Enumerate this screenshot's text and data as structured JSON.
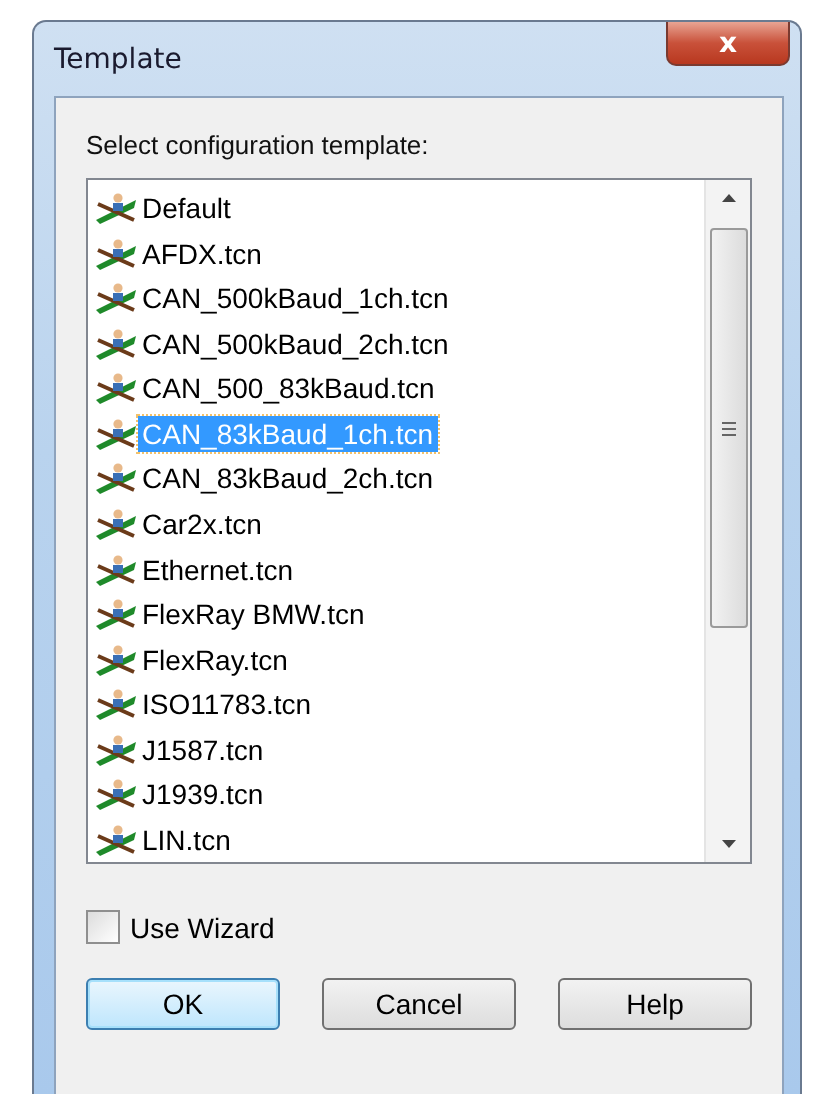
{
  "window": {
    "title": "Template",
    "close": "x"
  },
  "prompt": "Select configuration template:",
  "templates": [
    {
      "label": "Default",
      "selected": false
    },
    {
      "label": "AFDX.tcn",
      "selected": false
    },
    {
      "label": "CAN_500kBaud_1ch.tcn",
      "selected": false
    },
    {
      "label": "CAN_500kBaud_2ch.tcn",
      "selected": false
    },
    {
      "label": "CAN_500_83kBaud.tcn",
      "selected": false
    },
    {
      "label": "CAN_83kBaud_1ch.tcn",
      "selected": true
    },
    {
      "label": "CAN_83kBaud_2ch.tcn",
      "selected": false
    },
    {
      "label": "Car2x.tcn",
      "selected": false
    },
    {
      "label": "Ethernet.tcn",
      "selected": false
    },
    {
      "label": "FlexRay BMW.tcn",
      "selected": false
    },
    {
      "label": "FlexRay.tcn",
      "selected": false
    },
    {
      "label": "ISO11783.tcn",
      "selected": false
    },
    {
      "label": "J1587.tcn",
      "selected": false
    },
    {
      "label": "J1939.tcn",
      "selected": false
    },
    {
      "label": "LIN.tcn",
      "selected": false
    }
  ],
  "use_wizard": {
    "label": "Use Wizard",
    "checked": false
  },
  "buttons": [
    {
      "label": "OK",
      "default": true
    },
    {
      "label": "Cancel",
      "default": false
    },
    {
      "label": "Help",
      "default": false
    }
  ]
}
